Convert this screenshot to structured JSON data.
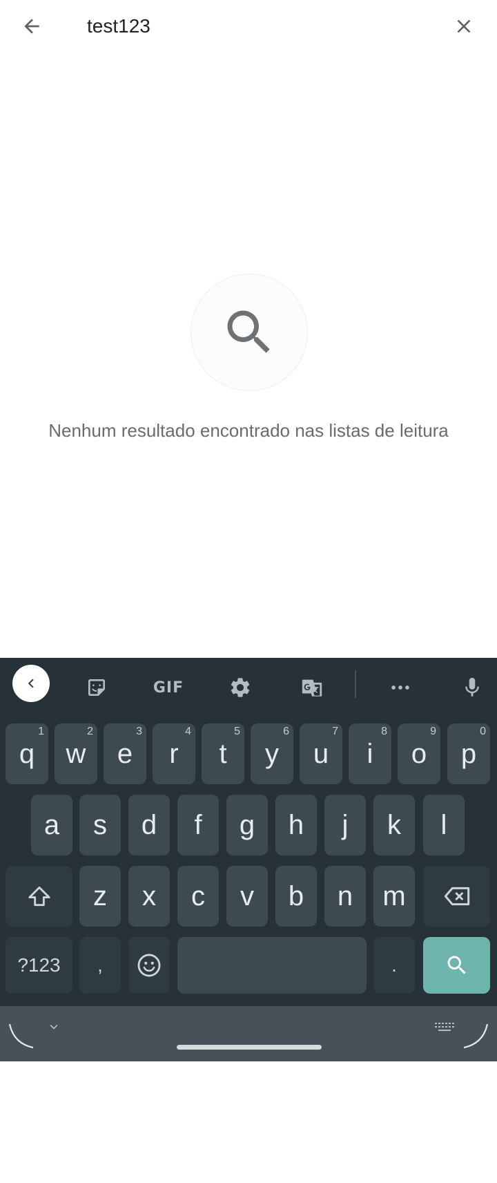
{
  "search": {
    "query": "test123"
  },
  "empty_state": {
    "message": "Nenhum resultado encontrado nas listas de leitura"
  },
  "keyboard": {
    "toolbar": {
      "gif_label": "GIF"
    },
    "row1": [
      {
        "key": "q",
        "hint": "1"
      },
      {
        "key": "w",
        "hint": "2"
      },
      {
        "key": "e",
        "hint": "3"
      },
      {
        "key": "r",
        "hint": "4"
      },
      {
        "key": "t",
        "hint": "5"
      },
      {
        "key": "y",
        "hint": "6"
      },
      {
        "key": "u",
        "hint": "7"
      },
      {
        "key": "i",
        "hint": "8"
      },
      {
        "key": "o",
        "hint": "9"
      },
      {
        "key": "p",
        "hint": "0"
      }
    ],
    "row2": [
      "a",
      "s",
      "d",
      "f",
      "g",
      "h",
      "j",
      "k",
      "l"
    ],
    "row3": [
      "z",
      "x",
      "c",
      "v",
      "b",
      "n",
      "m"
    ],
    "row4": {
      "symbols_label": "?123",
      "comma": ",",
      "period": "."
    }
  },
  "colors": {
    "keyboard_bg": "#263238",
    "key_bg": "#3d4a52",
    "search_key": "#6cb4ac"
  }
}
